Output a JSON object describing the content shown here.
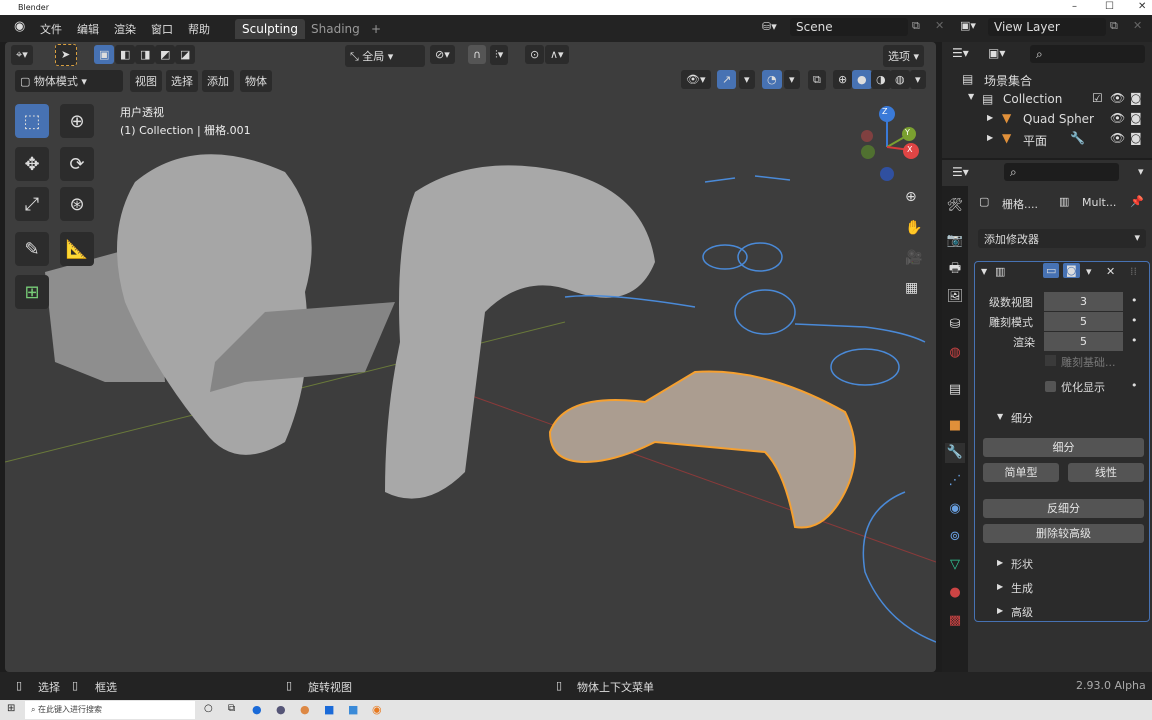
{
  "title_bar": {
    "app_name": "Blender",
    "minimize": "–",
    "maximize": "☐",
    "close": "✕"
  },
  "menu": [
    "文件",
    "编辑",
    "渲染",
    "窗口",
    "帮助"
  ],
  "workspaces": [
    {
      "label": "Sculpting",
      "active": true
    },
    {
      "label": "Shading",
      "active": false
    }
  ],
  "add_workspace": "+",
  "scene": {
    "name": "Scene"
  },
  "view_layer": {
    "name": "View Layer"
  },
  "viewport_header": {
    "transform_orientation": "全局",
    "options": "选项",
    "mode": "物体模式",
    "menus": [
      "视图",
      "选择",
      "添加",
      "物体"
    ]
  },
  "viewport": {
    "view_name": "用户透视",
    "collection_info": "(1) Collection | 栅格.001",
    "gizmo_axes": [
      "Z",
      "Y",
      "X"
    ],
    "accent_color": "#f5a030"
  },
  "outliner": {
    "root": "场景集合",
    "items": [
      {
        "name": "Collection",
        "level": 0
      },
      {
        "name": "Quad Spher",
        "level": 1
      },
      {
        "name": "平面",
        "level": 1
      }
    ]
  },
  "properties": {
    "object_name": "栅格....",
    "modifier_name": "Mult...",
    "add_modifier": "添加修改器",
    "fields": [
      {
        "label": "级数视图",
        "value": "3"
      },
      {
        "label": "雕刻模式",
        "value": "5"
      },
      {
        "label": "渲染",
        "value": "5"
      }
    ],
    "sculpt_base": "雕刻基础...",
    "optimal_display": "优化显示",
    "subdivide_section": "细分",
    "buttons": {
      "subdivide": "细分",
      "simple": "简单型",
      "linear": "线性",
      "unsubdivide": "反细分",
      "delete_higher": "删除较高级"
    },
    "collapsed_sections": [
      "形状",
      "生成",
      "高级"
    ]
  },
  "status_bar": {
    "select": "选择",
    "box_select": "框选",
    "rotate_view": "旋转视图",
    "context_menu": "物体上下文菜单",
    "version": "2.93.0 Alpha"
  },
  "taskbar": {
    "search_placeholder": "在此键入进行搜索"
  }
}
